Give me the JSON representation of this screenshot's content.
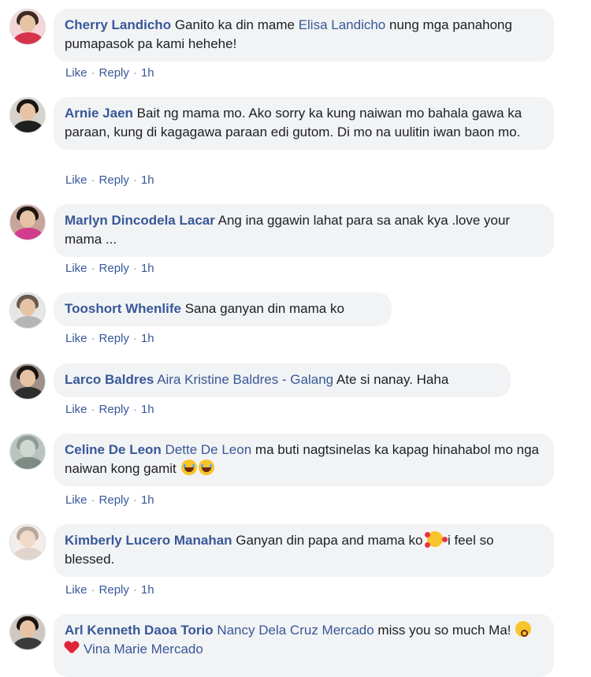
{
  "comments": [
    {
      "author": "Cherry Landicho",
      "segments": [
        {
          "type": "text",
          "value": "Ganito ka din mame "
        },
        {
          "type": "mention",
          "value": "Elisa Landicho"
        },
        {
          "type": "text",
          "value": " nung mga panahong pumapasok pa kami hehehe!"
        }
      ],
      "like_label": "Like",
      "reply_label": "Reply",
      "time": "1h",
      "avatar_icon": "avatar-photo-icon"
    },
    {
      "author": "Arnie Jaen",
      "segments": [
        {
          "type": "text",
          "value": "Bait ng mama mo. Ako sorry ka kung naiwan mo bahala gawa ka paraan, kung di kagagawa paraan edi gutom. Di mo na uulitin iwan baon mo."
        }
      ],
      "like_label": "Like",
      "reply_label": "Reply",
      "time": "1h",
      "avatar_icon": "avatar-photo-icon"
    },
    {
      "author": "Marlyn Dincodela Lacar",
      "segments": [
        {
          "type": "text",
          "value": "Ang ina ggawin lahat para sa anak kya .love your mama ..."
        }
      ],
      "like_label": "Like",
      "reply_label": "Reply",
      "time": "1h",
      "avatar_icon": "avatar-photo-icon"
    },
    {
      "author": "Tooshort Whenlife",
      "segments": [
        {
          "type": "text",
          "value": "Sana ganyan din mama ko"
        }
      ],
      "like_label": "Like",
      "reply_label": "Reply",
      "time": "1h",
      "avatar_icon": "avatar-photo-icon"
    },
    {
      "author": "Larco Baldres",
      "segments": [
        {
          "type": "mention",
          "value": "Aira Kristine Baldres - Galang"
        },
        {
          "type": "text",
          "value": " Ate si nanay. Haha"
        }
      ],
      "like_label": "Like",
      "reply_label": "Reply",
      "time": "1h",
      "avatar_icon": "avatar-photo-icon"
    },
    {
      "author": "Celine De Leon",
      "segments": [
        {
          "type": "mention",
          "value": "Dette De Leon"
        },
        {
          "type": "text",
          "value": " ma buti nagtsinelas ka kapag hinahabol mo nga naiwan kong gamit"
        },
        {
          "type": "emoji",
          "value": "laughing-tears-emoji"
        },
        {
          "type": "emoji",
          "value": "laughing-tears-emoji"
        }
      ],
      "like_label": "Like",
      "reply_label": "Reply",
      "time": "1h",
      "avatar_icon": "avatar-photo-icon"
    },
    {
      "author": "Kimberly Lucero Manahan",
      "segments": [
        {
          "type": "text",
          "value": "Ganyan din papa and mama ko "
        },
        {
          "type": "emoji",
          "value": "smiling-hearts-emoji"
        },
        {
          "type": "text",
          "value": " i feel so blessed."
        }
      ],
      "like_label": "Like",
      "reply_label": "Reply",
      "time": "1h",
      "avatar_icon": "avatar-photo-icon"
    },
    {
      "author": "Arl Kenneth Daoa Torio",
      "segments": [
        {
          "type": "mention",
          "value": "Nancy Dela Cruz Mercado"
        },
        {
          "type": "text",
          "value": " miss you so much Ma! "
        },
        {
          "type": "emoji",
          "value": "kissing-emoji"
        },
        {
          "type": "emoji",
          "value": "red-heart-emoji"
        },
        {
          "type": "mention",
          "value": "Vina Marie Mercado"
        }
      ],
      "like_label": "",
      "reply_label": "",
      "time": "",
      "avatar_icon": "avatar-photo-icon"
    }
  ],
  "colors": {
    "link": "#385898",
    "bubble": "#f2f3f5",
    "meta": "#90949c"
  }
}
